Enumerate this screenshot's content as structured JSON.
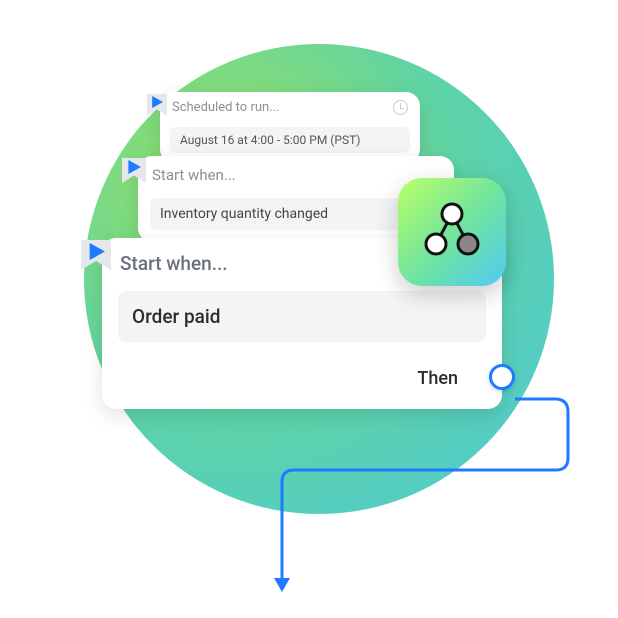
{
  "cards": {
    "scheduled": {
      "title": "Scheduled to run...",
      "value": "August 16 at 4:00 - 5:00 PM (PST)"
    },
    "trigger_mid": {
      "title": "Start when...",
      "value": "Inventory quantity changed"
    },
    "trigger_front": {
      "title": "Start when...",
      "value": "Order paid",
      "then": "Then"
    }
  },
  "colors": {
    "accent_blue": "#1e7bff"
  }
}
